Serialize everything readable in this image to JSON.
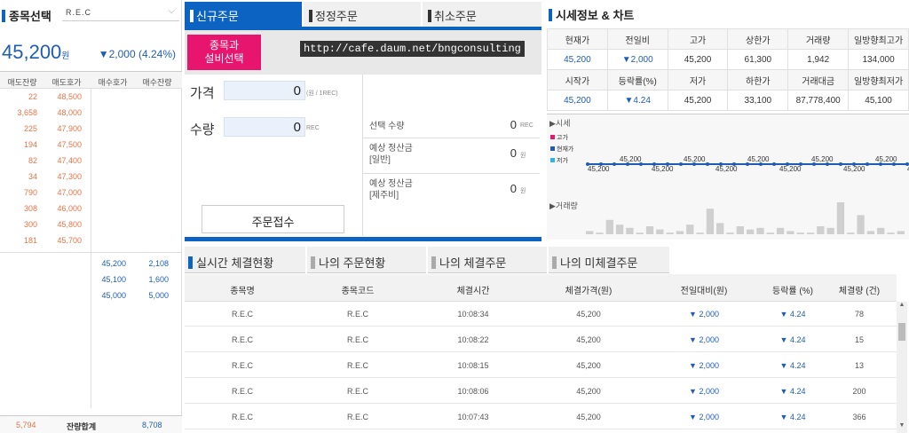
{
  "left": {
    "title": "종목선택",
    "stock_select_value": "R.E.C",
    "current_price": "45,200",
    "price_unit": "원",
    "change_text": "▼2,000 (4.24%)",
    "headers": [
      "매도잔량",
      "매도호가",
      "매수호가",
      "매수잔량"
    ],
    "asks": [
      {
        "qty": "22",
        "price": "48,500"
      },
      {
        "qty": "3,658",
        "price": "48,000"
      },
      {
        "qty": "225",
        "price": "47,900"
      },
      {
        "qty": "194",
        "price": "47,500"
      },
      {
        "qty": "82",
        "price": "47,400"
      },
      {
        "qty": "34",
        "price": "47,300"
      },
      {
        "qty": "790",
        "price": "47,000"
      },
      {
        "qty": "308",
        "price": "46,000"
      },
      {
        "qty": "300",
        "price": "45,800"
      },
      {
        "qty": "181",
        "price": "45,700"
      }
    ],
    "bids": [
      {
        "price": "45,200",
        "qty": "2,108"
      },
      {
        "price": "45,100",
        "qty": "1,600"
      },
      {
        "price": "45,000",
        "qty": "5,000"
      }
    ],
    "total_ask": "5,794",
    "total_label": "잔량합계",
    "total_bid": "8,708"
  },
  "order": {
    "tabs": [
      "신규주문",
      "정정주문",
      "취소주문"
    ],
    "select_btn_line1": "종목과",
    "select_btn_line2": "설비선택",
    "url": "http://cafe.daum.net/bngconsulting",
    "price_label": "가격",
    "price_value": "0",
    "price_unit": "(원 / 1REC)",
    "qty_label": "수량",
    "qty_value": "0",
    "qty_unit": "REC",
    "submit": "주문접수",
    "sel_qty_label": "선택 수량",
    "sel_qty_value": "0",
    "sel_qty_unit": "REC",
    "est1_line1": "예상 정산금",
    "est1_line2": "[일반]",
    "est1_value": "0",
    "est1_unit": "원",
    "est2_line1": "예상 정산금",
    "est2_line2": "[제주비]",
    "est2_value": "0",
    "est2_unit": "원"
  },
  "market": {
    "title": "시세정보 & 차트",
    "row1_headers": [
      "현재가",
      "전일비",
      "고가",
      "상한가",
      "거래량",
      "일방향최고가"
    ],
    "row1_values": [
      "45,200",
      "▼2,000",
      "45,200",
      "61,300",
      "1,942",
      "134,000"
    ],
    "row2_headers": [
      "시작가",
      "등락률(%)",
      "저가",
      "하한가",
      "거래대금",
      "일방향최저가"
    ],
    "row2_values": [
      "45,200",
      "▼4.24",
      "45,200",
      "33,100",
      "87,778,400",
      "45,100"
    ],
    "chart_price_title": "▶시세",
    "legend": [
      {
        "label": "고가",
        "color": "#e8156e"
      },
      {
        "label": "현재가",
        "color": "#1f5db5"
      },
      {
        "label": "저가",
        "color": "#2ab4e8"
      }
    ],
    "price_labels": [
      "45,200",
      "45,200",
      "45,200",
      "45,200",
      "45,200",
      "45,200",
      "45,200",
      "45,200",
      "45,200",
      "45,200",
      "45,200"
    ],
    "volume_title": "▶거래량"
  },
  "chart_data": {
    "type": "line",
    "price_points": 25,
    "price_value": 45200,
    "volume_bars": [
      2,
      1,
      9,
      6,
      4,
      1,
      5,
      3,
      1,
      2,
      6,
      1,
      16,
      7,
      1,
      5,
      3,
      4,
      1,
      4,
      2,
      1,
      1,
      5,
      4,
      20,
      1,
      12,
      2,
      4,
      1,
      2
    ]
  },
  "trades": {
    "tabs": [
      "실시간 체결현황",
      "나의 주문현황",
      "나의 체결주문",
      "나의 미체결주문"
    ],
    "headers": [
      "종목명",
      "종목코드",
      "체결시간",
      "체결가격(원)",
      "전일대비(원)",
      "등락률 (%)",
      "체결량 (건)"
    ],
    "rows": [
      {
        "name": "R.E.C",
        "code": "R.E.C",
        "time": "10:08:34",
        "price": "45,200",
        "diff": "▼ 2,000",
        "rate": "▼ 4.24",
        "qty": "78"
      },
      {
        "name": "R.E.C",
        "code": "R.E.C",
        "time": "10:08:22",
        "price": "45,200",
        "diff": "▼ 2,000",
        "rate": "▼ 4.24",
        "qty": "15"
      },
      {
        "name": "R.E.C",
        "code": "R.E.C",
        "time": "10:08:15",
        "price": "45,200",
        "diff": "▼ 2,000",
        "rate": "▼ 4.24",
        "qty": "13"
      },
      {
        "name": "R.E.C",
        "code": "R.E.C",
        "time": "10:08:06",
        "price": "45,200",
        "diff": "▼ 2,000",
        "rate": "▼ 4.24",
        "qty": "200"
      },
      {
        "name": "R.E.C",
        "code": "R.E.C",
        "time": "10:07:43",
        "price": "45,200",
        "diff": "▼ 2,000",
        "rate": "▼ 4.24",
        "qty": "366"
      }
    ]
  }
}
